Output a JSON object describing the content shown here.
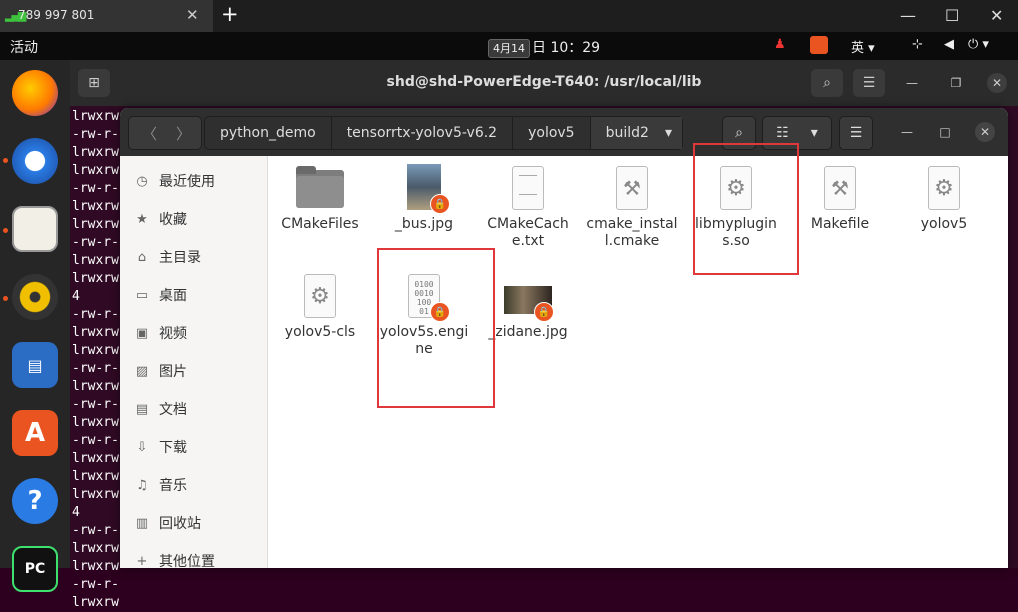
{
  "remote_tab": {
    "label": "789 997 801",
    "close": "✕"
  },
  "remote_controls": {
    "new_tab": "+",
    "minimize": "—",
    "maximize": "☐",
    "close": "✕"
  },
  "topbar": {
    "activities": "活动",
    "date_dropdown": "4月14",
    "clock": "日 10：29",
    "input_method": "英 ▾",
    "system_menu": "⏻ ▾"
  },
  "terminal": {
    "title": "shd@shd-PowerEdge-T640: /usr/local/lib",
    "lines": [
      "lrwxrw",
      "-rw-r-",
      "lrwxrw",
      "lrwxrw",
      "-rw-r-",
      "lrwxrw",
      "lrwxrw",
      "-rw-r-",
      "lrwxrw",
      "lrwxrw",
      "4",
      "-rw-r-",
      "lrwxrw",
      "lrwxrw",
      "-rw-r-",
      "lrwxrw",
      "-rw-r-",
      "lrwxrw",
      "-rw-r-",
      "lrwxrw",
      "lrwxrw",
      "lrwxrw",
      "4",
      "-rw-r-",
      "lrwxrw",
      "lrwxrw",
      "-rw-r-",
      "lrwxrw"
    ]
  },
  "file_manager": {
    "nav": {
      "back": "〈",
      "forward": "〉"
    },
    "breadcrumbs": [
      "python_demo",
      "tensorrtx-yolov5-v6.2",
      "yolov5",
      "build2"
    ],
    "breadcrumb_menu": "▾",
    "sidebar": [
      {
        "label": "最近使用",
        "icon": "clock-icon",
        "glyph": "◷"
      },
      {
        "label": "收藏",
        "icon": "star-icon",
        "glyph": "★"
      },
      {
        "label": "主目录",
        "icon": "home-icon",
        "glyph": "⌂"
      },
      {
        "label": "桌面",
        "icon": "desktop-icon",
        "glyph": "▭"
      },
      {
        "label": "视频",
        "icon": "video-icon",
        "glyph": "▣"
      },
      {
        "label": "图片",
        "icon": "picture-icon",
        "glyph": "▨"
      },
      {
        "label": "文档",
        "icon": "document-icon",
        "glyph": "▤"
      },
      {
        "label": "下载",
        "icon": "download-icon",
        "glyph": "⇩"
      },
      {
        "label": "音乐",
        "icon": "music-icon",
        "glyph": "♫"
      },
      {
        "label": "回收站",
        "icon": "trash-icon",
        "glyph": "▥"
      },
      {
        "label": "其他位置",
        "icon": "plus-icon",
        "glyph": "+"
      }
    ],
    "files": [
      {
        "name": "CMakeFiles",
        "kind": "folder"
      },
      {
        "name": "_bus.jpg",
        "kind": "image-locked"
      },
      {
        "name": "CMakeCache.txt",
        "kind": "text"
      },
      {
        "name": "cmake_install.cmake",
        "kind": "script"
      },
      {
        "name": "libmyplugins.so",
        "kind": "library"
      },
      {
        "name": "Makefile",
        "kind": "script"
      },
      {
        "name": "yolov5",
        "kind": "executable"
      },
      {
        "name": "yolov5-cls",
        "kind": "executable"
      },
      {
        "name": "yolov5s.engine",
        "kind": "binary-locked"
      },
      {
        "name": "_zidane.jpg",
        "kind": "image-locked"
      }
    ]
  },
  "colors": {
    "ubuntu_orange": "#e95420",
    "terminal_bg": "#300a24",
    "highlight": "#e0373a"
  }
}
